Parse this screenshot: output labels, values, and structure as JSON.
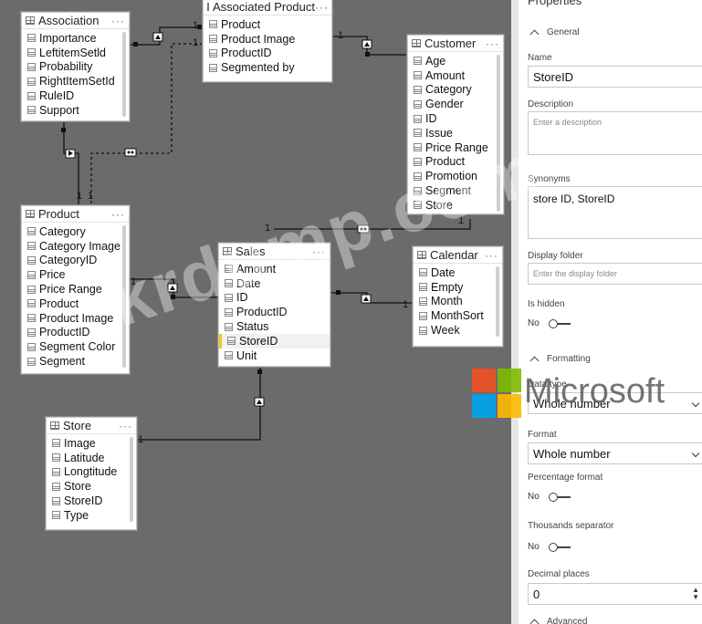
{
  "tables": [
    {
      "id": "association",
      "title": "Association",
      "fields": [
        "Importance",
        "LeftitemSetld",
        "Probability",
        "RightItemSetId",
        "RuleID",
        "Support"
      ]
    },
    {
      "id": "associated-product",
      "title": "Associated Product",
      "fields": [
        "Product",
        "Product Image",
        "ProductID",
        "Segmented by"
      ]
    },
    {
      "id": "customer",
      "title": "Customer",
      "fields": [
        "Age",
        "Amount",
        "Category",
        "Gender",
        "ID",
        "Issue",
        "Price Range",
        "Product",
        "Promotion",
        "Segment",
        "Store"
      ]
    },
    {
      "id": "product",
      "title": "Product",
      "fields": [
        "Category",
        "Category Image",
        "CategoryID",
        "Price",
        "Price Range",
        "Product",
        "Product Image",
        "ProductID",
        "Segment Color",
        "Segment"
      ]
    },
    {
      "id": "sales",
      "title": "Sales",
      "fields": [
        "Amount",
        "Date",
        "ID",
        "ProductID",
        "Status",
        "StoreID",
        "Unit"
      ]
    },
    {
      "id": "calendar",
      "title": "Calendar",
      "fields": [
        "Date",
        "Empty",
        "Month",
        "MonthSort",
        "Week"
      ]
    },
    {
      "id": "store",
      "title": "Store",
      "fields": [
        "Image",
        "Latitude",
        "Longtitude",
        "Store",
        "StoreID",
        "Type"
      ]
    }
  ],
  "relations": {
    "assoc_prod_left": "1",
    "assoc_prod_top": "1",
    "assoc_prod_bottom": "1",
    "aprod_customer": "1",
    "assoc_product_a": "1",
    "assoc_product_b": "1",
    "customer_sales_left": "1",
    "customer_sales_right": "1",
    "product_sales": "1",
    "calendar_sales": "1",
    "store_sales": "1"
  },
  "properties": {
    "title": "Properties",
    "general_label": "General",
    "name_label": "Name",
    "name_value": "StoreID",
    "description_label": "Description",
    "description_placeholder": "Enter a description",
    "synonyms_label": "Synonyms",
    "synonyms_value": "store ID, StoreID",
    "display_folder_label": "Display folder",
    "display_folder_placeholder": "Enter the display folder",
    "is_hidden_label": "Is hidden",
    "is_hidden_value": "No",
    "formatting_label": "Formatting",
    "data_type_label": "Data type",
    "data_type_value": "Whole number",
    "format_label": "Format",
    "format_value": "Whole number",
    "percentage_label": "Percentage format",
    "percentage_value": "No",
    "thousands_label": "Thousands separator",
    "thousands_value": "No",
    "decimal_label": "Decimal places",
    "decimal_value": "0",
    "advanced_label": "Advanced"
  },
  "watermarks": {
    "site": "krdump.com",
    "brand": "Microsoft",
    "logo_colors": [
      "#f25022",
      "#7fba00",
      "#00a4ef",
      "#ffb900"
    ]
  },
  "colors": {
    "canvas": "#6b6b6b",
    "selected_accent": "#f2c811"
  }
}
